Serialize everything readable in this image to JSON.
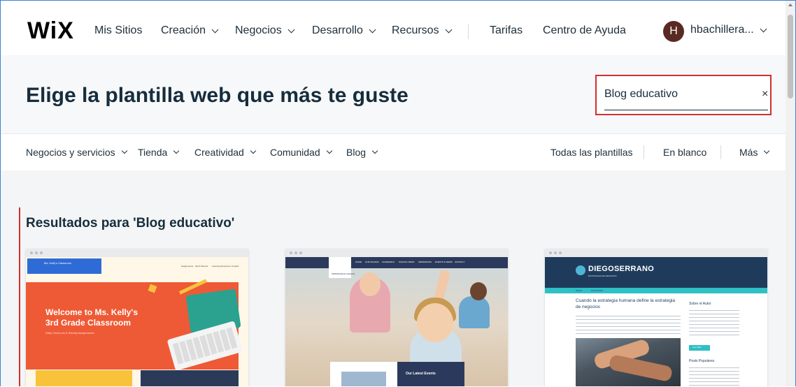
{
  "nav": {
    "logo": "WiX",
    "items": [
      {
        "label": "Mis Sitios",
        "dropdown": false
      },
      {
        "label": "Creación",
        "dropdown": true
      },
      {
        "label": "Negocios",
        "dropdown": true
      },
      {
        "label": "Desarrollo",
        "dropdown": true
      },
      {
        "label": "Recursos",
        "dropdown": true
      }
    ],
    "pricing": "Tarifas",
    "help": "Centro de Ayuda",
    "avatar_initial": "H",
    "user_name": "hbachillera..."
  },
  "header": {
    "title": "Elige la plantilla web que más te guste",
    "search_value": "Blog educativo",
    "clear_icon": "×"
  },
  "categories": {
    "left": [
      "Negocios y servicios",
      "Tienda",
      "Creatividad",
      "Comunidad",
      "Blog"
    ],
    "all_templates": "Todas las plantillas",
    "blank": "En blanco",
    "more": "Más"
  },
  "results": {
    "heading": "Resultados para 'Blog educativo'",
    "templates": [
      {
        "logo_text": "Ms. Kelly's Classroom",
        "menu": [
          "Assignments",
          "Kid & Parents",
          "Learning Resources",
          "Contact"
        ],
        "hero_title": "Welcome to Ms. Kelly's 3rd Grade Classroom",
        "hero_sub": "Daily Check-ins & Weekly Assignments"
      },
      {
        "school": "SPRINGFIELD SCHOOL",
        "menu": [
          "HOME",
          "OUR SCHOOL",
          "ACADEMICS",
          "SCHOOL NEWS",
          "ADMISSIONS",
          "EVENTS & NEWS",
          "CONTACT"
        ],
        "events_label": "Our Latest Events"
      },
      {
        "brand": "DIEGOSERRANO",
        "brand_sub": "ESTRATEGIA DE NEGOCIOS",
        "tabs": [
          "INICIO",
          "NOSOTROS"
        ],
        "post_title": "Cuando la estrategia humana define la estrategia de negocios",
        "sidebar_about": "Sobre el Autor",
        "button": "Leer Más",
        "sidebar_popular": "Posts Populares"
      }
    ]
  },
  "colors": {
    "accent_red": "#d32f2f",
    "text": "#162d3d",
    "frame_blue": "#3b82d6"
  }
}
